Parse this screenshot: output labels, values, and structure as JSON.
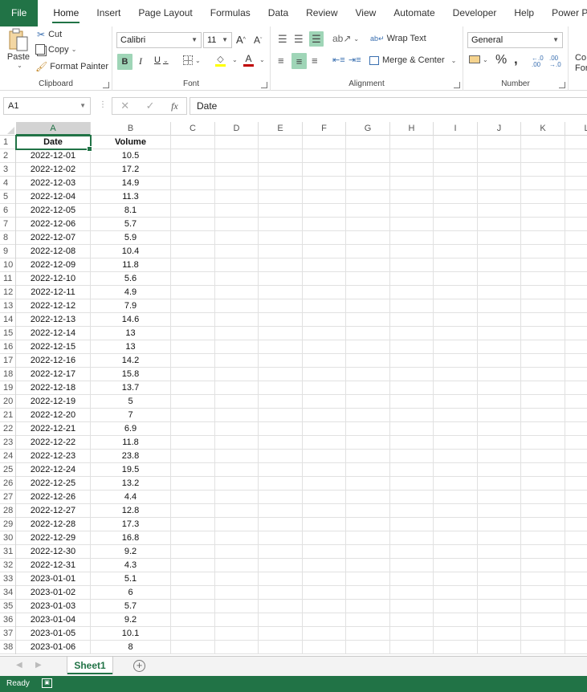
{
  "tabs": [
    "File",
    "Home",
    "Insert",
    "Page Layout",
    "Formulas",
    "Data",
    "Review",
    "View",
    "Automate",
    "Developer",
    "Help",
    "Power Pivot"
  ],
  "active_tab": "Home",
  "ribbon": {
    "clipboard": {
      "label": "Clipboard",
      "paste": "Paste",
      "cut": "Cut",
      "copy": "Copy",
      "format_painter": "Format Painter"
    },
    "font": {
      "label": "Font",
      "font_name": "Calibri",
      "font_size": "11",
      "bold": "B",
      "italic": "I",
      "underline": "U",
      "grow": "A",
      "shrink": "A",
      "font_color_letter": "A",
      "highlight_color": "#ffff00",
      "font_color": "#c00000"
    },
    "alignment": {
      "label": "Alignment",
      "wrap_text": "Wrap Text",
      "merge_center": "Merge & Center"
    },
    "number": {
      "label": "Number",
      "format": "General",
      "percent": "%",
      "comma": ",",
      "increase_decimal": "←.0 .00",
      "decrease_decimal": ".00 →.0"
    },
    "styles_partial": {
      "line1": "Co",
      "line2": "For"
    }
  },
  "formula_bar": {
    "name_box": "A1",
    "fx": "fx",
    "content": "Date"
  },
  "columns": [
    "A",
    "B",
    "C",
    "D",
    "E",
    "F",
    "G",
    "H",
    "I",
    "J",
    "K",
    "L"
  ],
  "sheet": {
    "header": [
      "Date",
      "Volume"
    ],
    "rows": [
      [
        "2022-12-01",
        "10.5"
      ],
      [
        "2022-12-02",
        "17.2"
      ],
      [
        "2022-12-03",
        "14.9"
      ],
      [
        "2022-12-04",
        "11.3"
      ],
      [
        "2022-12-05",
        "8.1"
      ],
      [
        "2022-12-06",
        "5.7"
      ],
      [
        "2022-12-07",
        "5.9"
      ],
      [
        "2022-12-08",
        "10.4"
      ],
      [
        "2022-12-09",
        "11.8"
      ],
      [
        "2022-12-10",
        "5.6"
      ],
      [
        "2022-12-11",
        "4.9"
      ],
      [
        "2022-12-12",
        "7.9"
      ],
      [
        "2022-12-13",
        "14.6"
      ],
      [
        "2022-12-14",
        "13"
      ],
      [
        "2022-12-15",
        "13"
      ],
      [
        "2022-12-16",
        "14.2"
      ],
      [
        "2022-12-17",
        "15.8"
      ],
      [
        "2022-12-18",
        "13.7"
      ],
      [
        "2022-12-19",
        "5"
      ],
      [
        "2022-12-20",
        "7"
      ],
      [
        "2022-12-21",
        "6.9"
      ],
      [
        "2022-12-22",
        "11.8"
      ],
      [
        "2022-12-23",
        "23.8"
      ],
      [
        "2022-12-24",
        "19.5"
      ],
      [
        "2022-12-25",
        "13.2"
      ],
      [
        "2022-12-26",
        "4.4"
      ],
      [
        "2022-12-27",
        "12.8"
      ],
      [
        "2022-12-28",
        "17.3"
      ],
      [
        "2022-12-29",
        "16.8"
      ],
      [
        "2022-12-30",
        "9.2"
      ],
      [
        "2022-12-31",
        "4.3"
      ],
      [
        "2023-01-01",
        "5.1"
      ],
      [
        "2023-01-02",
        "6"
      ],
      [
        "2023-01-03",
        "5.7"
      ],
      [
        "2023-01-04",
        "9.2"
      ],
      [
        "2023-01-05",
        "10.1"
      ],
      [
        "2023-01-06",
        "8"
      ]
    ]
  },
  "sheet_tabs": [
    "Sheet1"
  ],
  "add_sheet": "+",
  "status": {
    "text": "Ready",
    "accent": "#217346"
  }
}
